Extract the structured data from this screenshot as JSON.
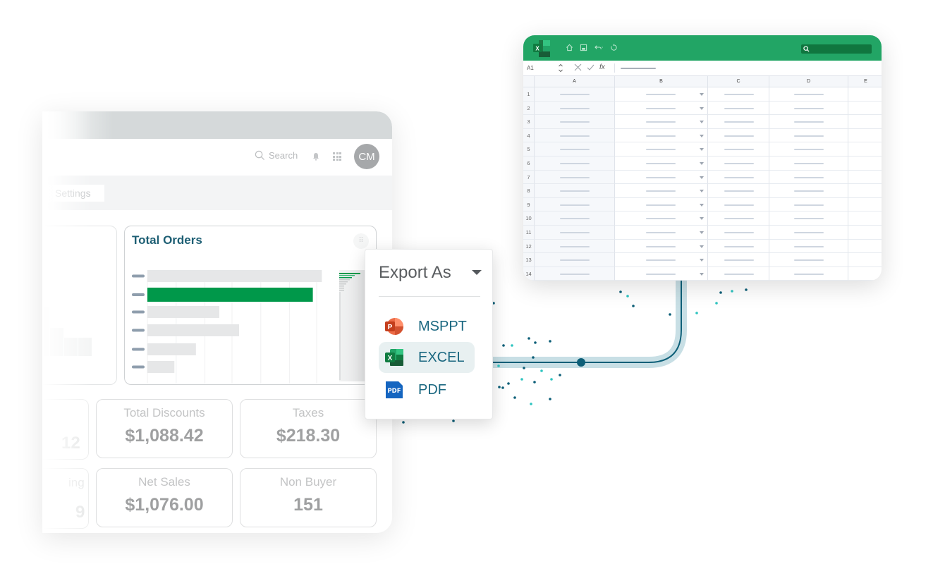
{
  "dashboard": {
    "header": {
      "search_label": "Search",
      "avatar_initials": "CM"
    },
    "tabs": [
      {
        "label": "Settings"
      }
    ],
    "orders_card": {
      "title": "Total Orders",
      "bars": [
        {
          "value": 0.97,
          "highlighted": false
        },
        {
          "value": 0.92,
          "highlighted": true
        },
        {
          "value": 0.4,
          "highlighted": false
        },
        {
          "value": 0.51,
          "highlighted": false
        },
        {
          "value": 0.27,
          "highlighted": false
        },
        {
          "value": 0.15,
          "highlighted": false
        }
      ],
      "highlight_color": "#00984a"
    },
    "kpis": [
      {
        "label": "Total Discounts",
        "value": "$1,088.42"
      },
      {
        "label": "Taxes",
        "value": "$218.30"
      },
      {
        "label": "Net Sales",
        "value": "$1,076.00"
      },
      {
        "label": "Non Buyer",
        "value": "151"
      }
    ],
    "partial_kpis": [
      {
        "label": "",
        "value": "12"
      },
      {
        "label": "ing",
        "value": "9"
      }
    ]
  },
  "export_menu": {
    "title": "Export As",
    "items": [
      {
        "label": "MSPPT",
        "icon": "powerpoint-icon",
        "selected": false
      },
      {
        "label": "EXCEL",
        "icon": "excel-icon",
        "selected": true
      },
      {
        "label": "PDF",
        "icon": "pdf-icon",
        "selected": false
      }
    ]
  },
  "spreadsheet": {
    "name_box": "A1",
    "formula_fx": "fx",
    "columns": [
      "A",
      "B",
      "C",
      "D",
      "E"
    ],
    "rows": [
      "1",
      "2",
      "3",
      "4",
      "5",
      "6",
      "7",
      "8",
      "9",
      "10",
      "11",
      "12",
      "13",
      "14"
    ],
    "accent": "#22a565"
  }
}
